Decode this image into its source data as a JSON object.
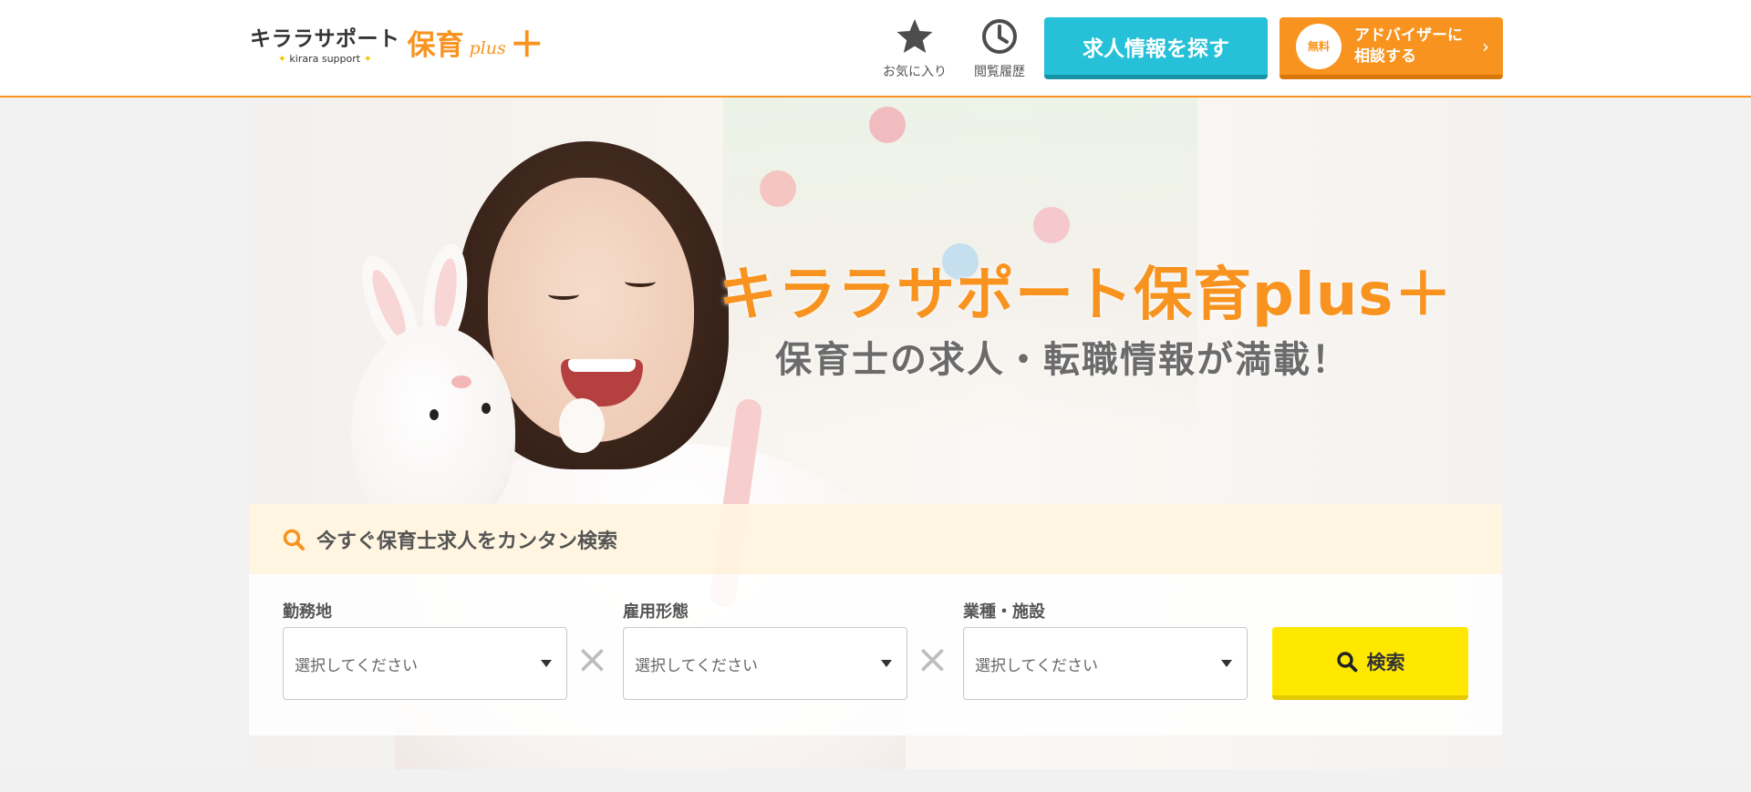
{
  "header": {
    "logo": {
      "jp": "キララサポート",
      "sub": "kirara support",
      "hoiku": "保育",
      "plus": "plus",
      "cross": "＋"
    },
    "favorites_label": "お気に入り",
    "history_label": "閲覧履歴",
    "search_jobs_label": "求人情報を探す",
    "advisor": {
      "badge": "無料",
      "label_line1": "アドバイザーに",
      "label_line2": "相談する"
    }
  },
  "hero": {
    "title": "キララサポート保育plus＋",
    "subtitle": "保育士の求人・転職情報が満載！"
  },
  "search": {
    "heading": "今すぐ保育士求人をカンタン検索",
    "fields": [
      {
        "label": "勤務地",
        "value": "選択してください"
      },
      {
        "label": "雇用形態",
        "value": "選択してください"
      },
      {
        "label": "業種・施設",
        "value": "選択してください"
      }
    ],
    "button_label": "検索"
  },
  "colors": {
    "accent_orange": "#f7931e",
    "cyan": "#26c1d9",
    "yellow": "#ffe800"
  }
}
